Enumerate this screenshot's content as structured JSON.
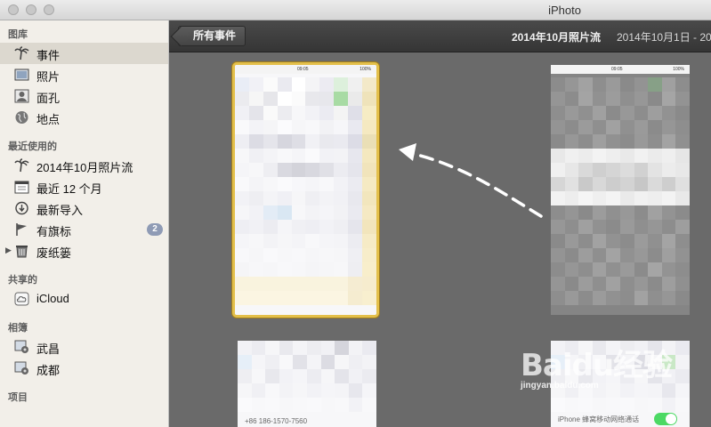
{
  "window": {
    "title": "iPhoto"
  },
  "sidebar": {
    "library_header": "图库",
    "library": [
      {
        "label": "事件",
        "icon": "palm-tree-icon",
        "selected": true
      },
      {
        "label": "照片",
        "icon": "photo-icon"
      },
      {
        "label": "面孔",
        "icon": "face-icon"
      },
      {
        "label": "地点",
        "icon": "globe-icon"
      }
    ],
    "recent_header": "最近使用的",
    "recent": [
      {
        "label": "2014年10月照片流",
        "icon": "palm-tree-icon"
      },
      {
        "label": "最近 12 个月",
        "icon": "calendar-icon"
      },
      {
        "label": "最新导入",
        "icon": "import-icon"
      },
      {
        "label": "有旗标",
        "icon": "flag-icon",
        "badge": "2"
      },
      {
        "label": "废纸篓",
        "icon": "trash-icon"
      }
    ],
    "shared_header": "共享的",
    "shared": [
      {
        "label": "iCloud",
        "icon": "cloud-icon"
      }
    ],
    "albums_header": "相簿",
    "albums": [
      {
        "label": "武昌",
        "icon": "smart-album-icon"
      },
      {
        "label": "成都",
        "icon": "smart-album-icon"
      }
    ],
    "projects_header": "项目"
  },
  "toolbar": {
    "back_label": "所有事件",
    "event_title": "2014年10月照片流",
    "date_range": "2014年10月1日 - 2014"
  },
  "content": {
    "phone_footer_left": "+86 186-1570-7560",
    "phone_footer_right": "iPhone 蜂窝移动网络通话",
    "status_time": "09:05",
    "status_battery": "100%"
  },
  "watermark": {
    "brand": "Baidu经验",
    "url": "jingyan.baidu.com"
  },
  "colors": {
    "selection_border": "#e3bf4a",
    "badge": "#8f9bb5",
    "toggle_on": "#4cd964"
  }
}
